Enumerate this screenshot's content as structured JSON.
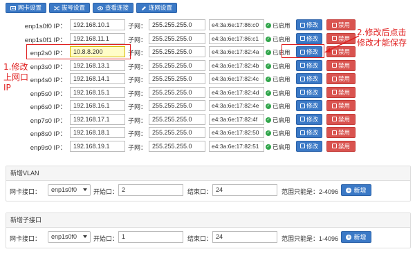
{
  "toolbar": {
    "items": [
      {
        "label": "网卡设置",
        "icon": "network-card-icon"
      },
      {
        "label": "拔号设置",
        "icon": "shuffle-icon"
      },
      {
        "label": "查看连接",
        "icon": "eye-icon"
      },
      {
        "label": "连网设置",
        "icon": "pencil-icon"
      }
    ]
  },
  "interfaces": {
    "subnet_label": "子网：",
    "status_text": "已启用",
    "edit_label": "修改",
    "disable_label": "禁用",
    "rows": [
      {
        "label": "enp1s0f0 IP：",
        "ip": "192.168.10.1",
        "mask": "255.255.255.0",
        "mac": "e4:3a:6e:17:86:c0"
      },
      {
        "label": "enp1s0f1 IP：",
        "ip": "192.168.11.1",
        "mask": "255.255.255.0",
        "mac": "e4:3a:6e:17:86:c1"
      },
      {
        "label": "enp2s0 IP：",
        "ip": "10.8.8.200",
        "mask": "255.255.255.0",
        "mac": "e4:3a:6e:17:82:4a"
      },
      {
        "label": "enp3s0 IP：",
        "ip": "192.168.13.1",
        "mask": "255.255.255.0",
        "mac": "e4:3a:6e:17:82:4b"
      },
      {
        "label": "enp4s0 IP：",
        "ip": "192.168.14.1",
        "mask": "255.255.255.0",
        "mac": "e4:3a:6e:17:82:4c"
      },
      {
        "label": "enp5s0 IP：",
        "ip": "192.168.15.1",
        "mask": "255.255.255.0",
        "mac": "e4:3a:6e:17:82:4d"
      },
      {
        "label": "enp6s0 IP：",
        "ip": "192.168.16.1",
        "mask": "255.255.255.0",
        "mac": "e4:3a:6e:17:82:4e"
      },
      {
        "label": "enp7s0 IP：",
        "ip": "192.168.17.1",
        "mask": "255.255.255.0",
        "mac": "e4:3a:6e:17:82:4f"
      },
      {
        "label": "enp8s0 IP：",
        "ip": "192.168.18.1",
        "mask": "255.255.255.0",
        "mac": "e4:3a:6e:17:82:50"
      },
      {
        "label": "enp9s0 IP：",
        "ip": "192.168.19.1",
        "mask": "255.255.255.0",
        "mac": "e4:3a:6e:17:82:51"
      }
    ]
  },
  "annotations": {
    "step1": "1.修改上网口IP",
    "step2": "2.修改后点击修改才能保存"
  },
  "vlan": {
    "title": "新增VLAN",
    "iface_label": "网卡接口：",
    "iface_value": "enp1s0f0",
    "start_label": "开始口：",
    "start_value": "2",
    "end_label": "结束口：",
    "end_value": "24",
    "range_text": "范围只能是：2-4096",
    "add_label": "新增"
  },
  "subif": {
    "title": "新增子接口",
    "iface_label": "网卡接口：",
    "iface_value": "enp1s0f0",
    "start_label": "开始口：",
    "start_value": "1",
    "end_label": "结束口：",
    "end_value": "24",
    "range_text": "范围只能是：1-4096",
    "add_label": "新增"
  },
  "colors": {
    "primary": "#3b79c6",
    "danger": "#d9534f",
    "annotation": "#e02020",
    "success": "#2fa54a"
  }
}
